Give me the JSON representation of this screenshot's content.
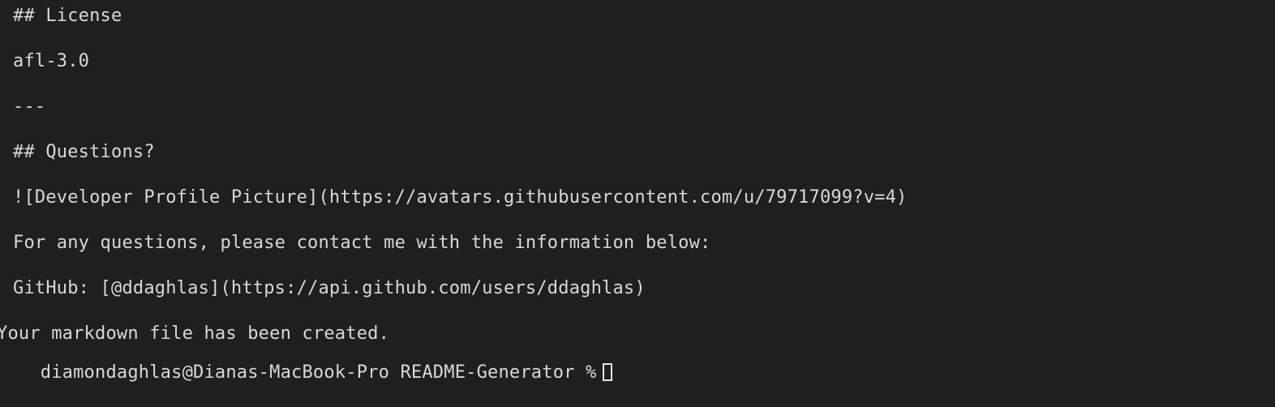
{
  "terminal": {
    "lines": [
      "## License",
      "afl-3.0",
      "---",
      "## Questions?",
      "![Developer Profile Picture](https://avatars.githubusercontent.com/u/79717099?v=4)",
      "For any questions, please contact me with the information below:",
      "GitHub: [@ddaghlas](https://api.github.com/users/ddaghlas)"
    ],
    "status_message": "Your markdown file has been created.",
    "prompt": "diamondaghlas@Dianas-MacBook-Pro README-Generator %"
  },
  "colors": {
    "background": "#1f1f1f",
    "text": "#d8d8d8",
    "cursor": "#e6e6e6"
  }
}
